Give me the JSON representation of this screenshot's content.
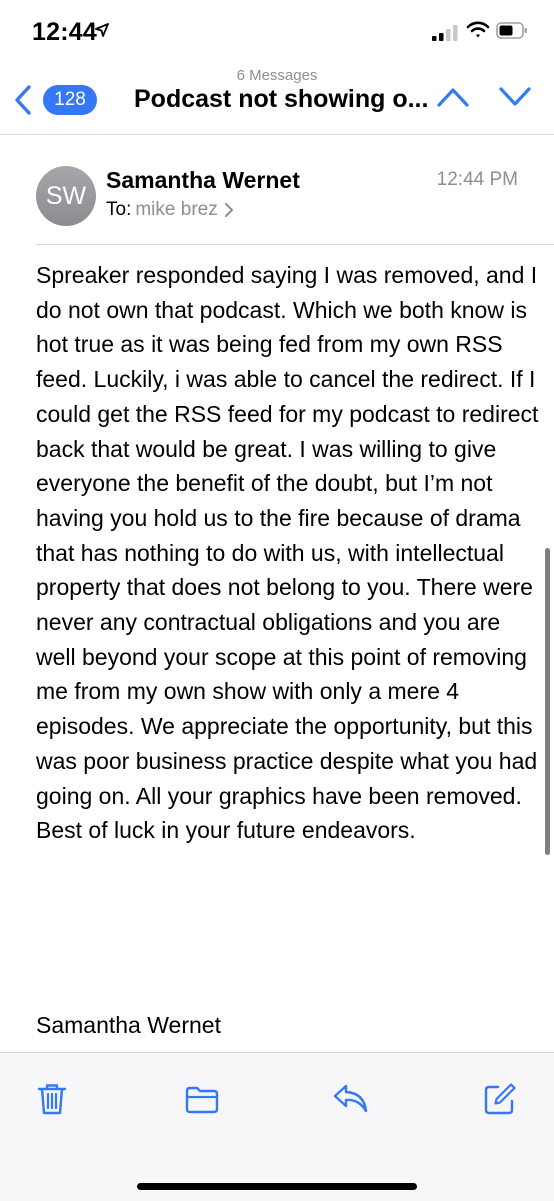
{
  "status": {
    "time": "12:44"
  },
  "nav": {
    "back_count": "128",
    "message_count": "6 Messages",
    "subject": "Podcast not showing o..."
  },
  "mail": {
    "avatar_initials": "SW",
    "sender": "Samantha Wernet",
    "to_label": "To:",
    "to_name": "mike brez",
    "time": "12:44 PM",
    "body": "Spreaker responded saying I was removed, and I do not own that podcast. Which we both know is hot true as it was being fed from my own RSS feed. Luckily, i was able to cancel the redirect. If I could get the RSS feed for my podcast to redirect back that would be great. I was willing to give everyone the benefit of the doubt, but I’m not having you hold us to the fire because of drama that has nothing to do with us, with intellectual property that does not belong to you. There were never any contractual obligations and you are well beyond your scope at this point of removing me from my own show with only a mere 4 episodes. We appreciate the opportunity, but this was poor business practice despite what you had going on. All your graphics have been removed. Best of luck in your future endeavors.",
    "signature": "Samantha Wernet"
  },
  "icons": {
    "back": "chevron-left-icon",
    "up": "chevron-up-icon",
    "down": "chevron-down-icon",
    "trash": "trash-icon",
    "folder": "folder-icon",
    "reply": "reply-icon",
    "compose": "compose-icon"
  },
  "colors": {
    "accent": "#3478f6",
    "secondary_text": "#8e8e93",
    "separator": "#d8d8dc",
    "toolbar_bg": "#f7f7f9"
  }
}
